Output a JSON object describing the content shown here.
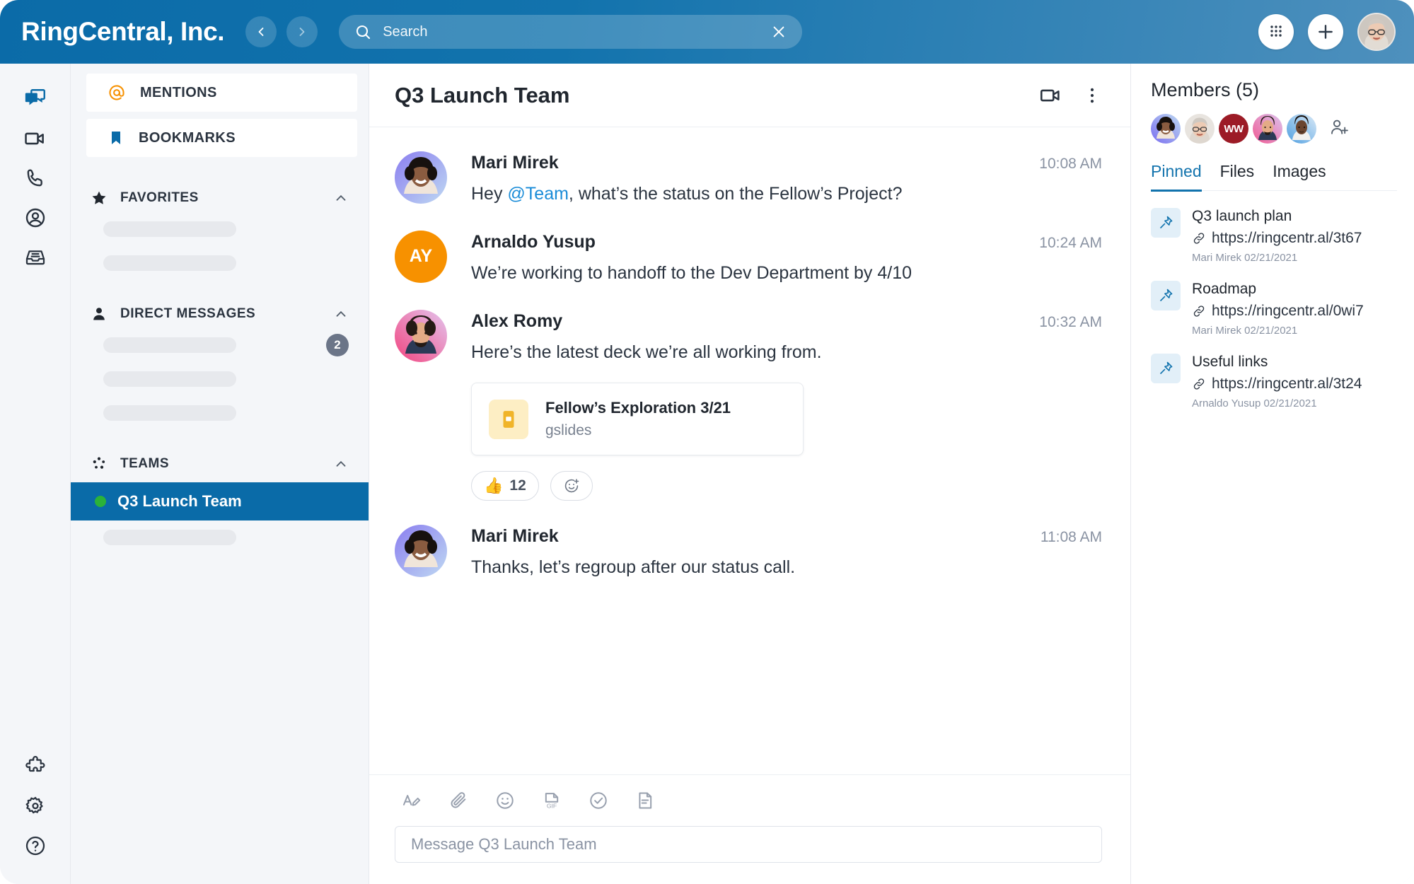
{
  "topbar": {
    "brand": "RingCentral, Inc.",
    "back_icon": "chevron-left-icon",
    "forward_icon": "chevron-right-icon",
    "search_placeholder": "Search",
    "search_value": "",
    "search_icon": "search-icon",
    "clear_icon": "close-icon",
    "dialpad_icon": "dialpad-icon",
    "add_icon": "plus-icon",
    "avatar": "user-avatar"
  },
  "rail": {
    "items": [
      {
        "name": "message",
        "icon": "chat-bubbles-icon",
        "active": true
      },
      {
        "name": "video",
        "icon": "video-camera-icon",
        "active": false
      },
      {
        "name": "phone",
        "icon": "phone-icon",
        "active": false
      },
      {
        "name": "contacts",
        "icon": "person-circle-icon",
        "active": false
      },
      {
        "name": "inbox",
        "icon": "inbox-tray-icon",
        "active": false
      }
    ],
    "bottom": [
      {
        "name": "apps",
        "icon": "puzzle-piece-icon"
      },
      {
        "name": "settings",
        "icon": "gear-icon"
      },
      {
        "name": "help",
        "icon": "question-circle-icon"
      }
    ]
  },
  "sidebar": {
    "mentions_label": "MENTIONS",
    "mentions_icon": "at-sign-icon",
    "bookmarks_label": "BOOKMARKS",
    "bookmarks_icon": "bookmark-icon",
    "favorites_label": "FAVORITES",
    "favorites_icon": "star-icon",
    "direct_messages_label": "DIRECT MESSAGES",
    "direct_messages_icon": "person-icon",
    "dm_badge": "2",
    "teams_label": "TEAMS",
    "teams_icon": "teams-dots-icon",
    "collapse_icon": "chevron-up-icon",
    "active_team": "Q3 Launch Team"
  },
  "conversation": {
    "title": "Q3 Launch Team",
    "video_icon": "video-camera-icon",
    "more_icon": "more-vertical-icon",
    "messages": [
      {
        "author": "Mari Mirek",
        "time": "10:08 AM",
        "text_before": "Hey ",
        "mention": "@Team",
        "text_after": ", what’s the status on the Fellow’s Project?",
        "avatar_type": "photo"
      },
      {
        "author": "Arnaldo Yusup",
        "time": "10:24 AM",
        "text": "We’re working to handoff to the Dev Department by 4/10",
        "avatar_type": "initials",
        "initials": "AY"
      },
      {
        "author": "Alex Romy",
        "time": "10:32 AM",
        "text": "Here’s the latest deck we’re all working from.",
        "avatar_type": "photo",
        "attachment": {
          "name": "Fellow’s Exploration 3/21",
          "type": "gslides",
          "icon": "slides-file-icon"
        },
        "reactions": [
          {
            "emoji": "👍",
            "count": "12"
          }
        ],
        "add_reaction_icon": "add-reaction-icon"
      },
      {
        "author": "Mari Mirek",
        "time": "11:08 AM",
        "text": "Thanks, let’s regroup after our status call.",
        "avatar_type": "photo"
      }
    ]
  },
  "composer": {
    "tools": [
      {
        "name": "format-text",
        "icon": "text-format-icon",
        "label": "A"
      },
      {
        "name": "attach-file",
        "icon": "paperclip-icon"
      },
      {
        "name": "insert-emoji",
        "icon": "smiley-icon"
      },
      {
        "name": "insert-gif",
        "icon": "gif-icon",
        "label": "GIF"
      },
      {
        "name": "create-task",
        "icon": "check-circle-icon"
      },
      {
        "name": "create-note",
        "icon": "note-icon"
      }
    ],
    "placeholder": "Message Q3 Launch Team"
  },
  "right_panel": {
    "members_title": "Members (5)",
    "member_avatars": [
      {
        "type": "photo",
        "name": "member-1"
      },
      {
        "type": "photo",
        "name": "member-2"
      },
      {
        "type": "initials",
        "initials": "WW",
        "name": "member-3"
      },
      {
        "type": "photo",
        "name": "member-4"
      },
      {
        "type": "photo",
        "name": "member-5"
      }
    ],
    "add_member_icon": "add-person-icon",
    "tabs": [
      {
        "label": "Pinned",
        "active": true
      },
      {
        "label": "Files",
        "active": false
      },
      {
        "label": "Images",
        "active": false
      }
    ],
    "pinned": [
      {
        "title": "Q3 launch plan",
        "link": "https://ringcentr.al/3t67",
        "meta": "Mari Mirek 02/21/2021",
        "icon": "pin-icon",
        "link_icon": "link-icon"
      },
      {
        "title": "Roadmap",
        "link": "https://ringcentr.al/0wi7",
        "meta": "Mari Mirek 02/21/2021",
        "icon": "pin-icon",
        "link_icon": "link-icon"
      },
      {
        "title": "Useful links",
        "link": "https://ringcentr.al/3t24",
        "meta": "Arnaldo Yusup 02/21/2021",
        "icon": "pin-icon",
        "link_icon": "link-icon"
      }
    ]
  },
  "colors": {
    "brand_blue": "#0a6ba8",
    "accent_orange": "#f79100",
    "mention_blue": "#1a8cd8",
    "online_green": "#2bb239",
    "sidebar_bg": "#f4f6f9"
  }
}
